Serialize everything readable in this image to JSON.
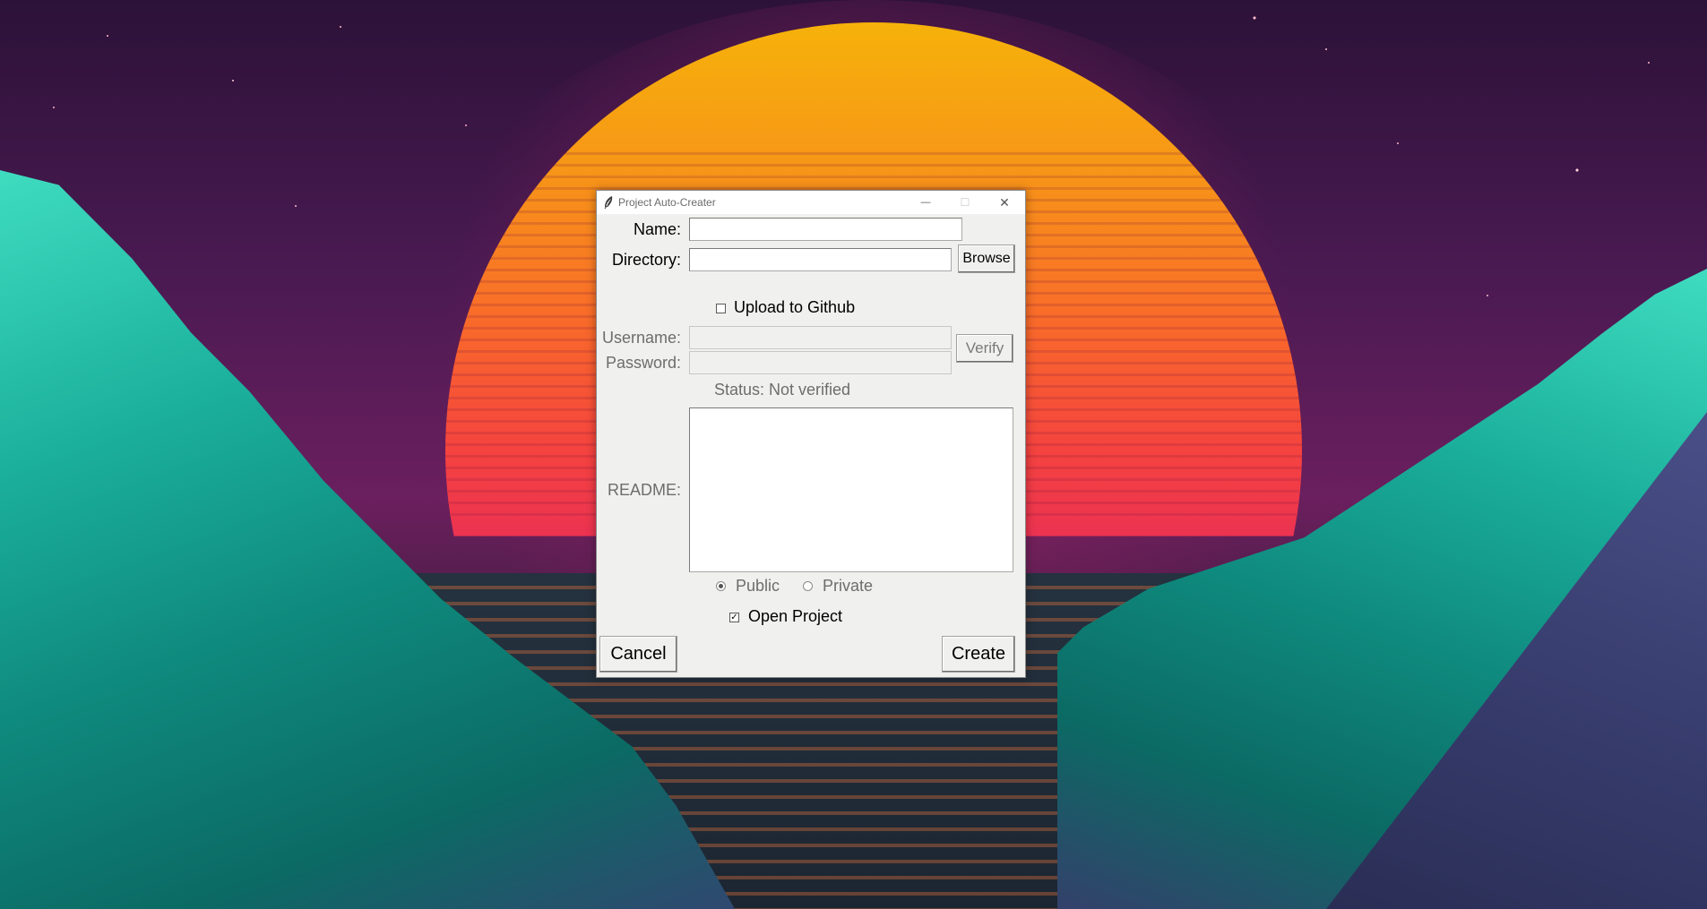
{
  "window": {
    "title": "Project Auto-Creater",
    "minimize_glyph": "—",
    "maximize_glyph": "☐",
    "close_glyph": "✕"
  },
  "form": {
    "name_label": "Name:",
    "name_value": "",
    "directory_label": "Directory:",
    "directory_value": "",
    "browse_label": "Browse",
    "upload_label": "Upload to Github",
    "upload_checked": false,
    "username_label": "Username:",
    "username_value": "",
    "password_label": "Password:",
    "password_value": "",
    "verify_label": "Verify",
    "status_text": "Status: Not verified",
    "readme_label": "README:",
    "readme_value": "",
    "visibility_options": [
      "Public",
      "Private"
    ],
    "visibility_selected": "Public",
    "open_project_label": "Open Project",
    "open_project_checked": true,
    "cancel_label": "Cancel",
    "create_label": "Create"
  },
  "colors": {
    "dialog_bg": "#f0f0ee",
    "disabled_text": "#6d6d6d",
    "titlebar_text": "#6b6b6b"
  }
}
